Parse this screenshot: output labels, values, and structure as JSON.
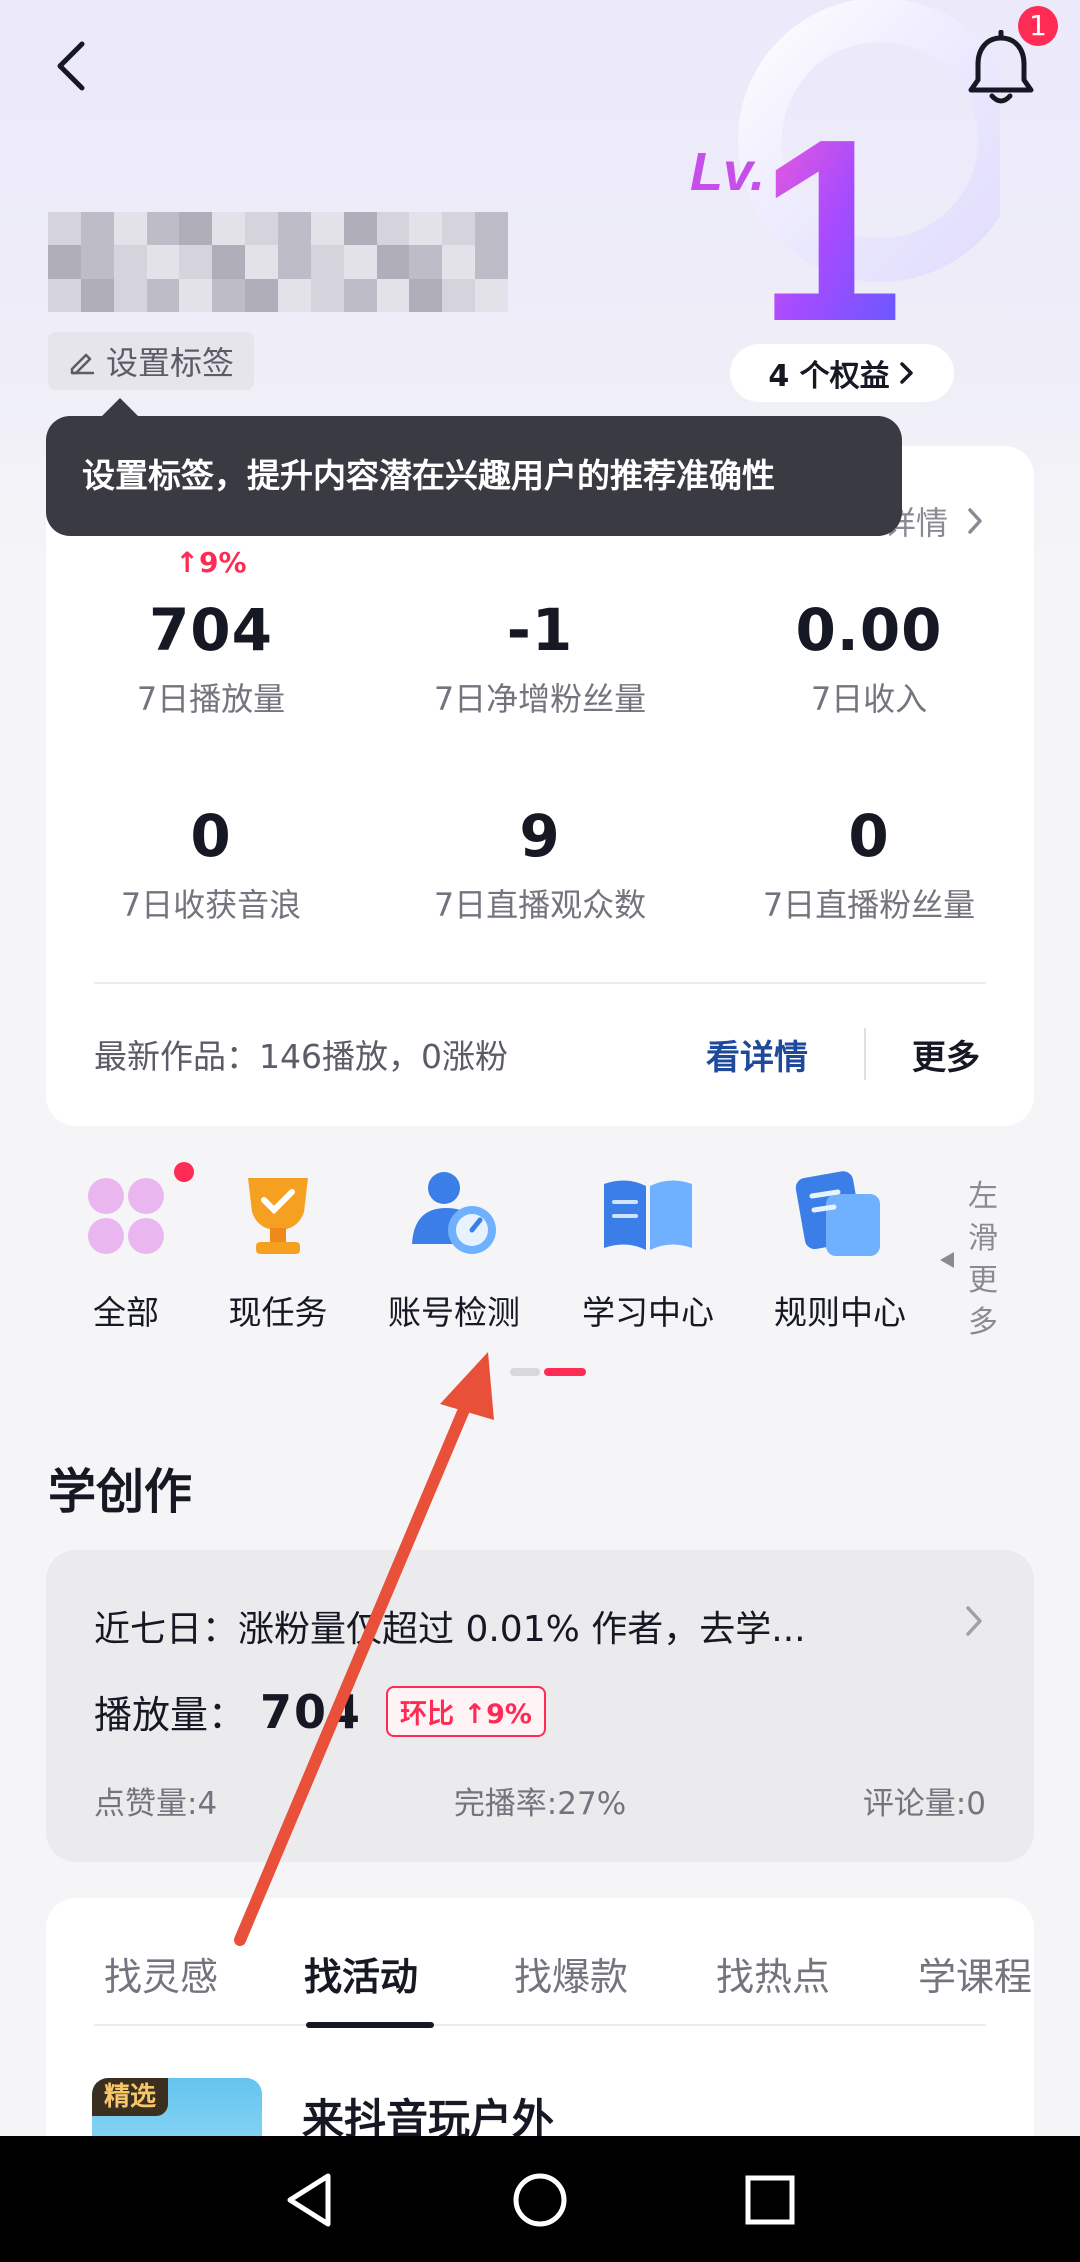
{
  "header": {
    "notification_count": "1",
    "level_text": "Lv.",
    "level_number": "1",
    "tag_button_label": "设置标签",
    "benefits_label": "4 个权益"
  },
  "tooltip": {
    "text": "设置标签，提升内容潜在兴趣用户的推荐准确性"
  },
  "stats": {
    "detail_label": "详情",
    "items": [
      {
        "value": "704",
        "label": "7日播放量",
        "trend": "↑9%"
      },
      {
        "value": "-1",
        "label": "7日净增粉丝量"
      },
      {
        "value": "0.00",
        "label": "7日收入"
      },
      {
        "value": "0",
        "label": "7日收获音浪"
      },
      {
        "value": "9",
        "label": "7日直播观众数"
      },
      {
        "value": "0",
        "label": "7日直播粉丝量"
      }
    ],
    "latest_work": "最新作品：146播放，0涨粉",
    "view_detail": "看详情",
    "more": "更多"
  },
  "shortcuts": {
    "items": [
      {
        "label": "全部",
        "icon": "grid-icon"
      },
      {
        "label": "现任务",
        "icon": "trophy-icon"
      },
      {
        "label": "账号检测",
        "icon": "account-check-icon"
      },
      {
        "label": "学习中心",
        "icon": "book-icon"
      },
      {
        "label": "规则中心",
        "icon": "rules-icon"
      }
    ],
    "swipe_hint": [
      "左",
      "滑",
      "更",
      "多"
    ]
  },
  "learn": {
    "section_title": "学创作",
    "summary": "近七日：涨粉量仅超过 0.01% 作者，去学...",
    "plays_label": "播放量：",
    "plays_value": "704",
    "plays_badge": "环比 ↑9%",
    "likes": "点赞量:4",
    "completion": "完播率:27%",
    "comments": "评论量:0"
  },
  "discover": {
    "tabs": [
      "找灵感",
      "找活动",
      "找爆款",
      "找热点",
      "学课程"
    ],
    "active_tab": "找活动",
    "item_badge": "精选",
    "item_title": "来抖音玩户外"
  },
  "colors": {
    "accent_red": "#fe2c55",
    "link_blue": "#1f4a9c",
    "arrow_red": "#e8503a"
  }
}
